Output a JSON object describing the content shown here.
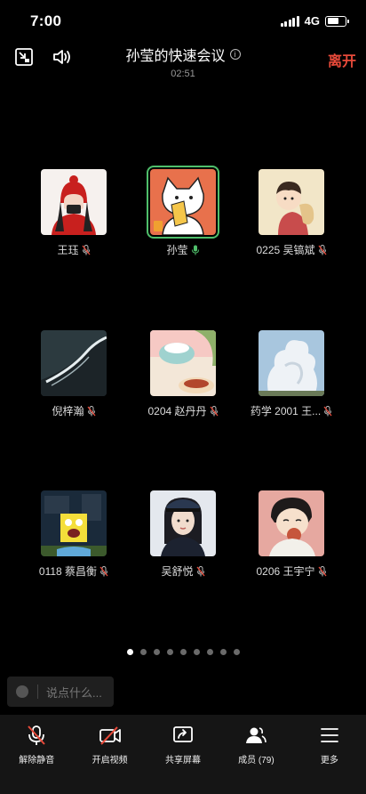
{
  "status": {
    "time": "7:00",
    "network": "4G",
    "battery_level": 0.65
  },
  "header": {
    "title": "孙莹的快速会议",
    "info_symbol": "i",
    "timer": "02:51",
    "leave_label": "离开"
  },
  "participants": [
    {
      "name": "王珏",
      "mic": "muted",
      "avatar": "avatar-girl-red-hat"
    },
    {
      "name": "孙莹",
      "mic": "active",
      "avatar": "avatar-cat-cartoon",
      "speaking": true
    },
    {
      "name": "0225 吴镐斌",
      "mic": "muted",
      "avatar": "avatar-cartoon-boy"
    },
    {
      "name": "倪梓瀚",
      "mic": "muted",
      "avatar": "avatar-sea-shore"
    },
    {
      "name": "0204 赵丹丹",
      "mic": "muted",
      "avatar": "avatar-cartoon-food"
    },
    {
      "name": "药学 2001 王...",
      "mic": "muted",
      "avatar": "avatar-clouds"
    },
    {
      "name": "0118 蔡昌衡",
      "mic": "muted",
      "avatar": "avatar-spongebob"
    },
    {
      "name": "吴舒悦",
      "mic": "muted",
      "avatar": "avatar-girl-portrait"
    },
    {
      "name": "0206 王宇宁",
      "mic": "muted",
      "avatar": "avatar-cartoon-eating"
    }
  ],
  "pager": {
    "total": 9,
    "active": 0
  },
  "chat": {
    "placeholder": "说点什么..."
  },
  "toolbar": {
    "unmute": "解除静音",
    "video": "开启视频",
    "share": "共享屏幕",
    "members": "成员 (79)",
    "more": "更多"
  },
  "colors": {
    "leave": "#e84a3a",
    "speaking": "#4fbf6b",
    "background": "#000000",
    "toolbar": "#151515"
  }
}
